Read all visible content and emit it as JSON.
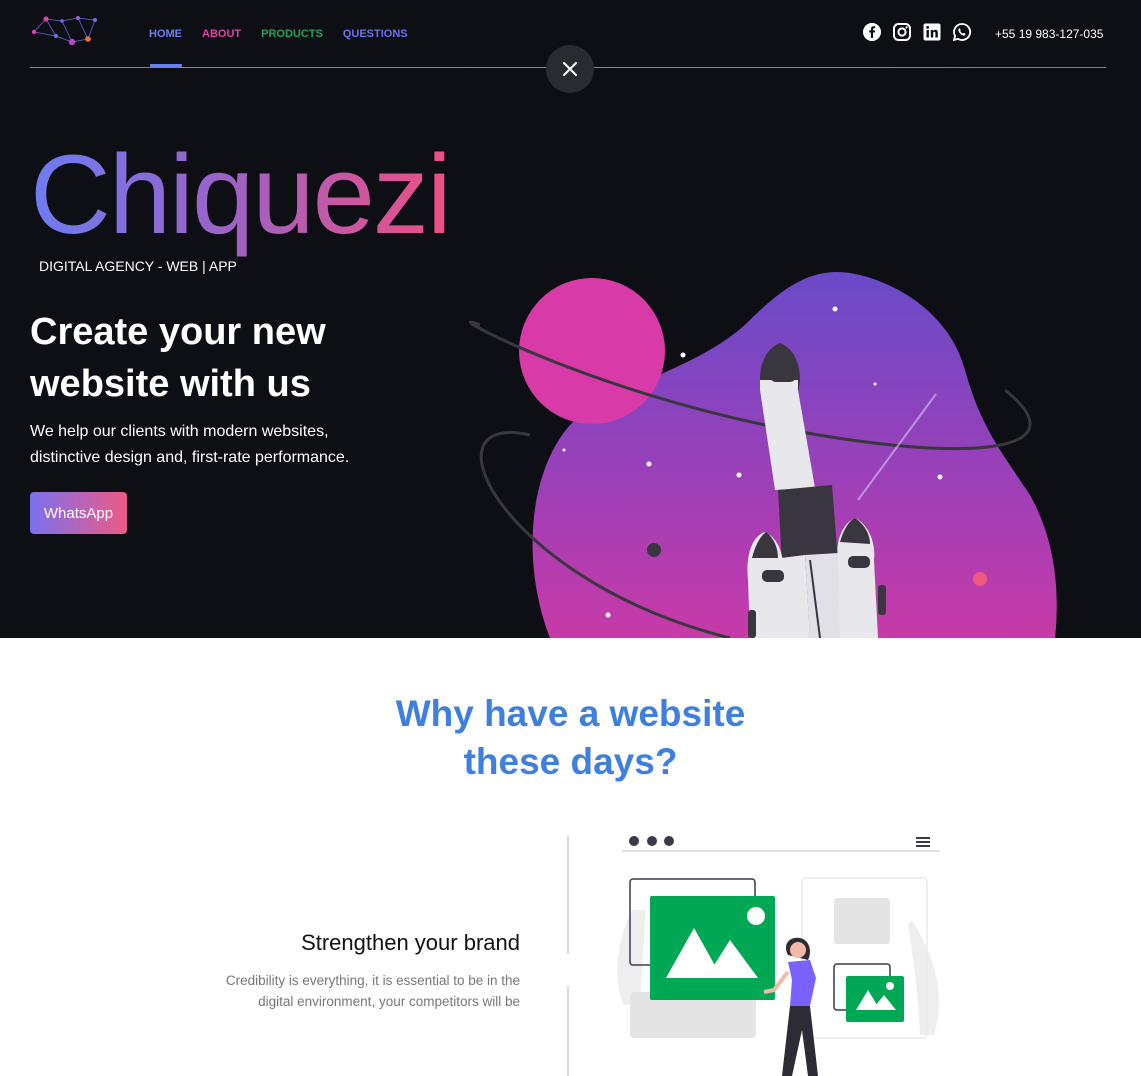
{
  "header": {
    "nav": [
      {
        "label": "HOME",
        "active": true,
        "color": "#6a7ff0"
      },
      {
        "label": "ABOUT",
        "color": "#e040a8"
      },
      {
        "label": "PRODUCTS",
        "color": "#20a45a"
      },
      {
        "label": "QUESTIONS",
        "color": "#6a6ff0"
      }
    ],
    "social_icons": [
      "facebook-icon",
      "instagram-icon",
      "linkedin-icon",
      "whatsapp-icon"
    ],
    "phone": "+55 19 983-127-035"
  },
  "hero": {
    "brand": "Chiquezi",
    "tagline": "DIGITAL AGENCY - WEB | APP",
    "headline": "Create your new website with us",
    "subtext": "We help our clients with modern websites, distinctive design and, first-rate performance.",
    "cta_label": "WhatsApp"
  },
  "section": {
    "title_line1": "Why have a website",
    "title_line2": "these days?",
    "feature_title": "Strengthen your brand",
    "feature_text_line1": "Credibility is everything, it is essential to be in the",
    "feature_text_line2": "digital environment, your competitors will be"
  },
  "colors": {
    "background_dark": "#0e0f14",
    "brand_gradient_start": "#6d7cf2",
    "brand_gradient_end": "#ee4f82",
    "section_title": "#3e7fe0",
    "illustration_green": "#00a854"
  }
}
